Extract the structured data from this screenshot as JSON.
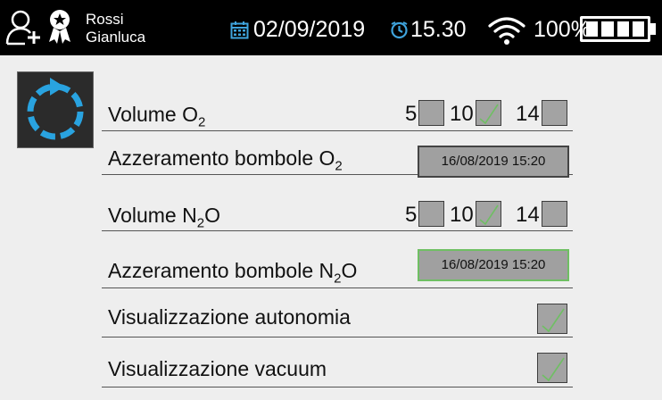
{
  "user": {
    "first_name": "Rossi",
    "last_name": "Gianluca",
    "icon": "user-add-icon",
    "badge_icon": "award-icon"
  },
  "status": {
    "date": "02/09/2019",
    "time": "15.30",
    "battery": "100%",
    "calendar_icon": "calendar-icon",
    "clock_icon": "clock-icon",
    "wifi_icon": "wifi-icon",
    "battery_icon": "battery-icon"
  },
  "refresh_button": {
    "icon": "refresh-icon"
  },
  "settings": {
    "volume_o2": {
      "label": "Volume O",
      "sub": "2",
      "options": [
        {
          "value": "5",
          "checked": false
        },
        {
          "value": "10",
          "checked": true
        },
        {
          "value": "14",
          "checked": false
        }
      ]
    },
    "reset_o2": {
      "label": "Azzeramento bombole O",
      "sub": "2",
      "value": "16/08/2019  15:20"
    },
    "volume_n2o": {
      "label": "Volume N",
      "sub": "2",
      "suffix": "O",
      "options": [
        {
          "value": "5",
          "checked": false
        },
        {
          "value": "10",
          "checked": true
        },
        {
          "value": "14",
          "checked": false
        }
      ]
    },
    "reset_n2o": {
      "label": "Azzeramento bombole N",
      "sub": "2",
      "suffix": "O",
      "value": "16/08/2019  15:20"
    },
    "show_autonomy": {
      "label": "Visualizzazione autonomia",
      "checked": true
    },
    "show_vacuum": {
      "label": "Visualizzazione vacuum",
      "checked": true
    }
  },
  "colors": {
    "topbar": "#000000",
    "background": "#eeeeee",
    "control": "#a3a3a3",
    "check": "#6fbf63",
    "selected_border": "#6fbf63"
  }
}
